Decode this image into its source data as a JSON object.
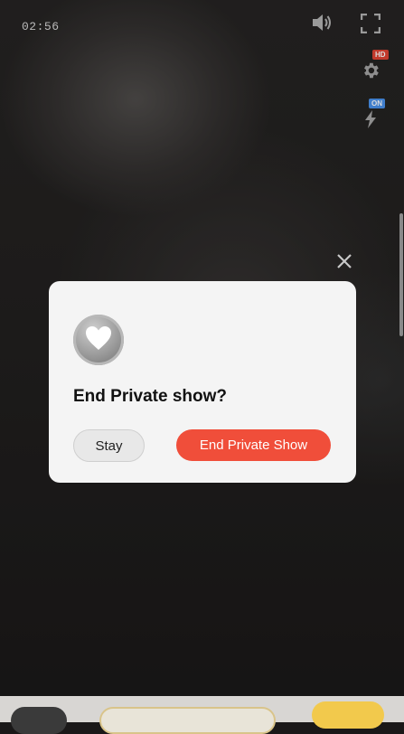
{
  "player": {
    "timer": "02:56",
    "hd_badge": "HD",
    "on_badge": "ON"
  },
  "dialog": {
    "title": "End Private show?",
    "stay_label": "Stay",
    "end_label": "End Private Show"
  },
  "colors": {
    "accent": "#f04e3a",
    "dialog_bg": "#f4f4f4",
    "hd_badge": "#c0392b",
    "on_badge": "#3f7ecb"
  },
  "icons": {
    "volume": "speaker-icon",
    "fullscreen": "fullscreen-icon",
    "settings": "gear-icon",
    "bolt": "lightning-icon",
    "close": "close-icon",
    "avatar": "heart-icon"
  }
}
